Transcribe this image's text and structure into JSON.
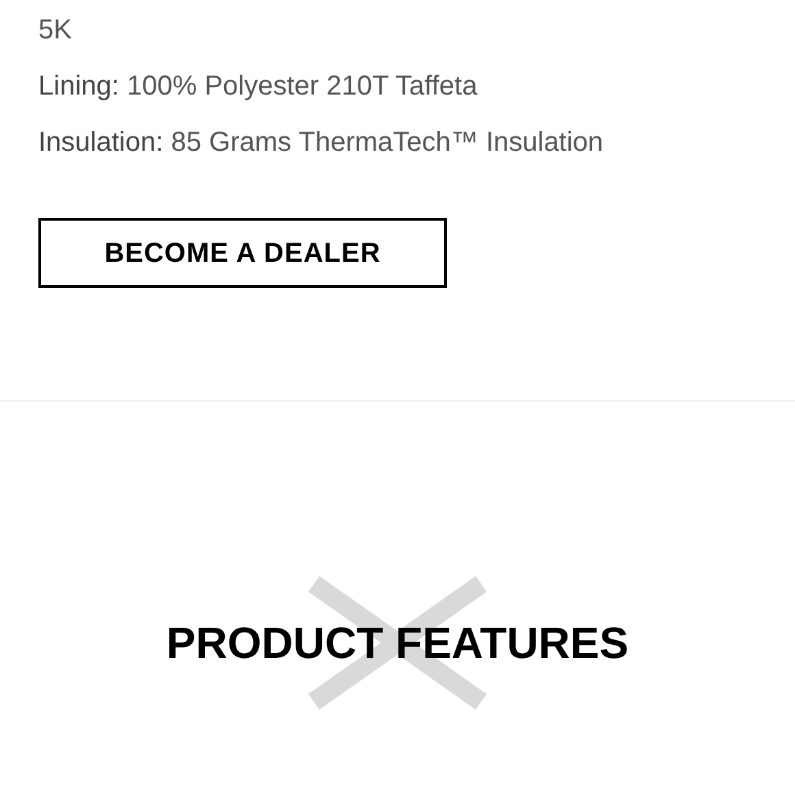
{
  "specs": [
    {
      "value": "5K"
    },
    {
      "label": "Lining:",
      "value": "100% Polyester 210T Taffeta"
    },
    {
      "label": "Insulation:",
      "value": "85 Grams ThermaTech™ Insulation"
    }
  ],
  "dealer_button": "BECOME A DEALER",
  "section_heading": "PRODUCT FEATURES"
}
